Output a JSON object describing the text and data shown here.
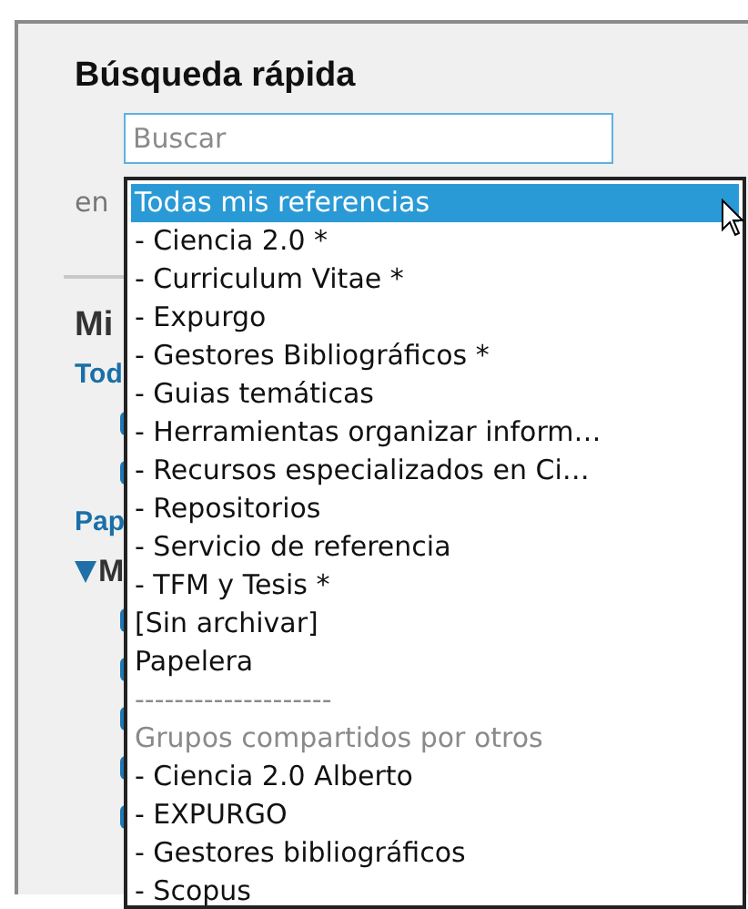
{
  "panel": {
    "title": "Búsqueda rápida",
    "search": {
      "placeholder": "Buscar"
    },
    "scope_label": "en",
    "behind": [
      {
        "kind": "heading",
        "text": "Mi"
      },
      {
        "kind": "link",
        "text": "Tod"
      },
      {
        "kind": "icon"
      },
      {
        "kind": "icon"
      },
      {
        "kind": "link",
        "text": "Pap"
      },
      {
        "kind": "tree",
        "text": "M",
        "expanded": true
      },
      {
        "kind": "icon"
      },
      {
        "kind": "icon"
      },
      {
        "kind": "icon"
      },
      {
        "kind": "icon"
      },
      {
        "kind": "icon"
      }
    ]
  },
  "dropdown": {
    "options": [
      {
        "kind": "option",
        "label": "Todas mis referencias",
        "selected": true
      },
      {
        "kind": "option",
        "label": "- Ciencia 2.0 *",
        "selected": false
      },
      {
        "kind": "option",
        "label": "- Curriculum Vitae *",
        "selected": false
      },
      {
        "kind": "option",
        "label": "- Expurgo",
        "selected": false
      },
      {
        "kind": "option",
        "label": "- Gestores Bibliográficos *",
        "selected": false
      },
      {
        "kind": "option",
        "label": "- Guias temáticas",
        "selected": false
      },
      {
        "kind": "option",
        "label": "- Herramientas organizar inform…",
        "selected": false
      },
      {
        "kind": "option",
        "label": "- Recursos especializados en Ci…",
        "selected": false
      },
      {
        "kind": "option",
        "label": "- Repositorios",
        "selected": false
      },
      {
        "kind": "option",
        "label": "- Servicio de referencia",
        "selected": false
      },
      {
        "kind": "option",
        "label": "- TFM y Tesis *",
        "selected": false
      },
      {
        "kind": "option",
        "label": "[Sin archivar]",
        "selected": false
      },
      {
        "kind": "option",
        "label": "Papelera",
        "selected": false
      },
      {
        "kind": "separator",
        "label": "--------------------"
      },
      {
        "kind": "header",
        "label": "Grupos compartidos por otros"
      },
      {
        "kind": "option",
        "label": "- Ciencia 2.0 Alberto",
        "selected": false
      },
      {
        "kind": "option",
        "label": "- EXPURGO",
        "selected": false
      },
      {
        "kind": "option",
        "label": "- Gestores bibliográficos",
        "selected": false
      },
      {
        "kind": "option",
        "label": "- Scopus",
        "selected": false
      }
    ]
  }
}
